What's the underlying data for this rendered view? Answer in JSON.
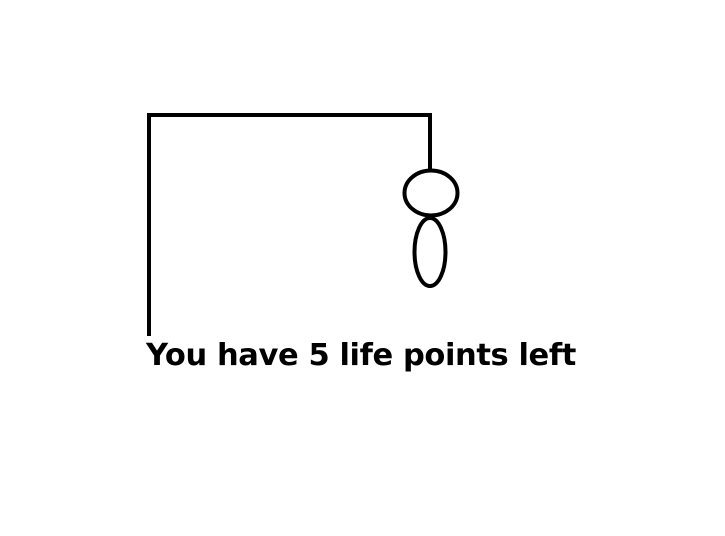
{
  "game": {
    "message": "You have 5 life points left",
    "life_points": 5,
    "drawn_parts": [
      "gallows-post",
      "gallows-beam",
      "rope",
      "head",
      "body"
    ]
  },
  "colors": {
    "background": "#ffffff",
    "ink": "#000000"
  }
}
